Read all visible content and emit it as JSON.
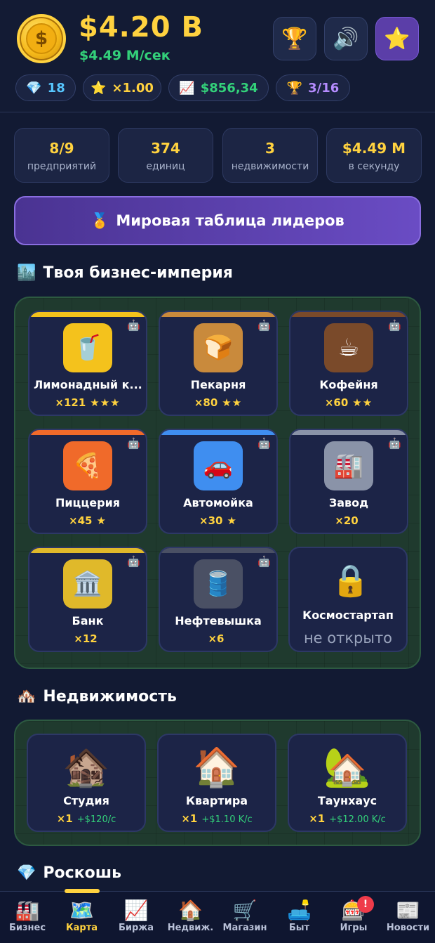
{
  "header": {
    "balance": "$4.20 B",
    "rate": "$4.49 M/сек",
    "buttons": [
      {
        "name": "trophy-icon",
        "glyph": "🏆"
      },
      {
        "name": "sound-icon",
        "glyph": "🔊"
      },
      {
        "name": "star-icon",
        "glyph": "⭐"
      }
    ],
    "pills": [
      {
        "icon": "💎",
        "value": "18",
        "color": "#57c7ff"
      },
      {
        "icon": "⭐",
        "value": "×1.00",
        "color": "#ffd23f"
      },
      {
        "icon": "📈",
        "value": "$856,34",
        "color": "#33d17a"
      },
      {
        "icon": "🏆",
        "value": "3/16",
        "color": "#b58cff"
      }
    ]
  },
  "stats": [
    {
      "value": "8/9",
      "label": "предприятий"
    },
    {
      "value": "374",
      "label": "единиц"
    },
    {
      "value": "3",
      "label": "недвижимости"
    },
    {
      "value": "$4.49 M",
      "label": "в секунду"
    }
  ],
  "leaderboard": {
    "icon": "🏅",
    "label": "Мировая таблица лидеров"
  },
  "business_section": {
    "icon": "🏙️",
    "title": "Твоя бизнес-империя"
  },
  "businesses": [
    {
      "name": "Лимонадный к...",
      "count": "×121",
      "stars": "★★★",
      "icon": "🥤",
      "icon_bg": "#f4c21c",
      "accent": "#f4c21c"
    },
    {
      "name": "Пекарня",
      "count": "×80",
      "stars": "★★",
      "icon": "🍞",
      "icon_bg": "#c98a3c",
      "accent": "#c98a3c"
    },
    {
      "name": "Кофейня",
      "count": "×60",
      "stars": "★★",
      "icon": "☕",
      "icon_bg": "#7a4a2a",
      "accent": "#7a4a2a"
    },
    {
      "name": "Пиццерия",
      "count": "×45",
      "stars": "★",
      "icon": "🍕",
      "icon_bg": "#f06a2a",
      "accent": "#f06a2a"
    },
    {
      "name": "Автомойка",
      "count": "×30",
      "stars": "★",
      "icon": "🚗",
      "icon_bg": "#3f8ef0",
      "accent": "#3f8ef0"
    },
    {
      "name": "Завод",
      "count": "×20",
      "stars": "",
      "icon": "🏭",
      "icon_bg": "#8a93a8",
      "accent": "#8a93a8"
    },
    {
      "name": "Банк",
      "count": "×12",
      "stars": "",
      "icon": "🏛️",
      "icon_bg": "#e0b92a",
      "accent": "#e0b92a"
    },
    {
      "name": "Нефтевышка",
      "count": "×6",
      "stars": "",
      "icon": "🛢️",
      "icon_bg": "#4a5064",
      "accent": "#4a5064"
    }
  ],
  "locked_business": {
    "name": "Космостартап",
    "status": "не открыто",
    "icon": "🔒"
  },
  "robot_icon": "🤖",
  "realty_section": {
    "icon": "🏘️",
    "title": "Недвижимость"
  },
  "realty": [
    {
      "name": "Студия",
      "count": "×1",
      "income": "+$120/с",
      "icon": "🏚️"
    },
    {
      "name": "Квартира",
      "count": "×1",
      "income": "+$1.10 K/с",
      "icon": "🏠"
    },
    {
      "name": "Таунхаус",
      "count": "×1",
      "income": "+$12.00 K/с",
      "icon": "🏡"
    }
  ],
  "luxury_section": {
    "icon": "💎",
    "title": "Роскошь"
  },
  "nav": [
    {
      "label": "Бизнес",
      "icon": "🏭"
    },
    {
      "label": "Карта",
      "icon": "🗺️"
    },
    {
      "label": "Биржа",
      "icon": "📈"
    },
    {
      "label": "Недвиж.",
      "icon": "🏠"
    },
    {
      "label": "Магазин",
      "icon": "🛒"
    },
    {
      "label": "Быт",
      "icon": "🛋️"
    },
    {
      "label": "Игры",
      "icon": "🎰",
      "badge": "!"
    },
    {
      "label": "Новости",
      "icon": "📰"
    }
  ],
  "nav_active": "Карта"
}
